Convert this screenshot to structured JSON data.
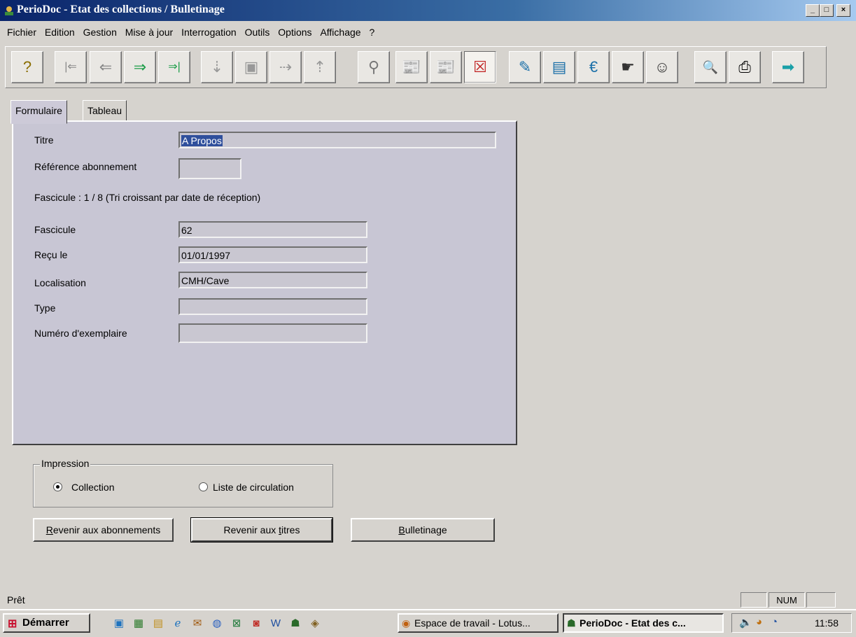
{
  "window": {
    "title": "PerioDoc - Etat des collections / Bulletinage",
    "min_label": "_",
    "max_label": "□",
    "close_label": "×"
  },
  "menu": [
    "Fichier",
    "Edition",
    "Gestion",
    "Mise à jour",
    "Interrogation",
    "Outils",
    "Options",
    "Affichage",
    "?"
  ],
  "toolbar": {
    "icons": [
      "help-icon",
      "first-record-icon",
      "previous-record-icon",
      "next-record-icon",
      "last-record-icon",
      "insert-record-icon",
      "save-record-icon",
      "duplicate-record-icon",
      "delete-record-icon",
      "find-icon",
      "newspaper-icon",
      "newspapers-icon",
      "checklist-icon",
      "edit-note-icon",
      "records-icon",
      "euro-icon",
      "hand-pointer-icon",
      "person-icon",
      "preview-icon",
      "print-icon",
      "exit-arrow-icon"
    ],
    "glyphs": [
      "?",
      "|⇐",
      "⇐",
      "⇒",
      "⇒|",
      "⇣",
      "▣",
      "⇢",
      "⇡",
      "⚲",
      "📰",
      "📰",
      "☒",
      "✎",
      "▤",
      "€",
      "☛",
      "☺",
      "🔍",
      "⎙",
      "➡"
    ]
  },
  "tabs": {
    "formulaire": "Formulaire",
    "tableau": "Tableau"
  },
  "form": {
    "titre_label": "Titre",
    "titre_value": "A Propos",
    "reference_label": "Référence abonnement",
    "reference_value": "",
    "fascicule_info": "Fascicule : 1 / 8   (Tri croissant par date de réception)",
    "fascicule_label": "Fascicule",
    "fascicule_value": "62",
    "recu_label": "Reçu le",
    "recu_value": "01/01/1997",
    "localisation_label": "Localisation",
    "localisation_value": "CMH/Cave",
    "type_label": "Type",
    "type_value": "",
    "numero_label": "Numéro d'exemplaire",
    "numero_value": ""
  },
  "impression": {
    "legend": "Impression",
    "collection": "Collection",
    "liste": "Liste de circulation",
    "selected": "Collection"
  },
  "buttons": {
    "abonnements_u": "R",
    "abonnements_rest": "evenir aux abonnements",
    "titres_pre": "Revenir aux ",
    "titres_u": "t",
    "titres_rest": "itres",
    "bulletinage_u": "B",
    "bulletinage_rest": "ulletinage"
  },
  "status": {
    "text": "Prêt",
    "num": "NUM"
  },
  "taskbar": {
    "start": "Démarrer",
    "task1": "Espace de travail - Lotus...",
    "task2": "PerioDoc - Etat des c...",
    "clock": "11:58"
  }
}
